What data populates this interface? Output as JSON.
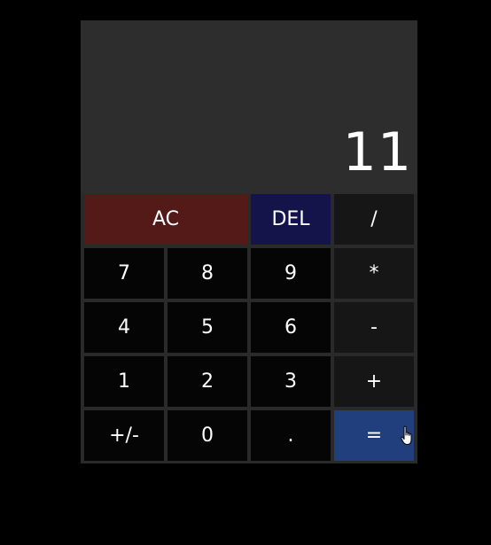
{
  "display": {
    "value": "11"
  },
  "keys": {
    "ac": "AC",
    "del": "DEL",
    "divide": "/",
    "seven": "7",
    "eight": "8",
    "nine": "9",
    "multiply": "*",
    "four": "4",
    "five": "5",
    "six": "6",
    "subtract": "-",
    "one": "1",
    "two": "2",
    "three": "3",
    "add": "+",
    "negate": "+/-",
    "zero": "0",
    "decimal": ".",
    "equals": "="
  },
  "colors": {
    "background": "#000000",
    "display": "#2d2d2d",
    "digit_key": "#050505",
    "operator_key": "#161616",
    "ac_key": "#531a18",
    "del_key": "#14144a",
    "equals_key": "#213f7c"
  },
  "icons": {
    "cursor": "hand-pointer-icon"
  }
}
